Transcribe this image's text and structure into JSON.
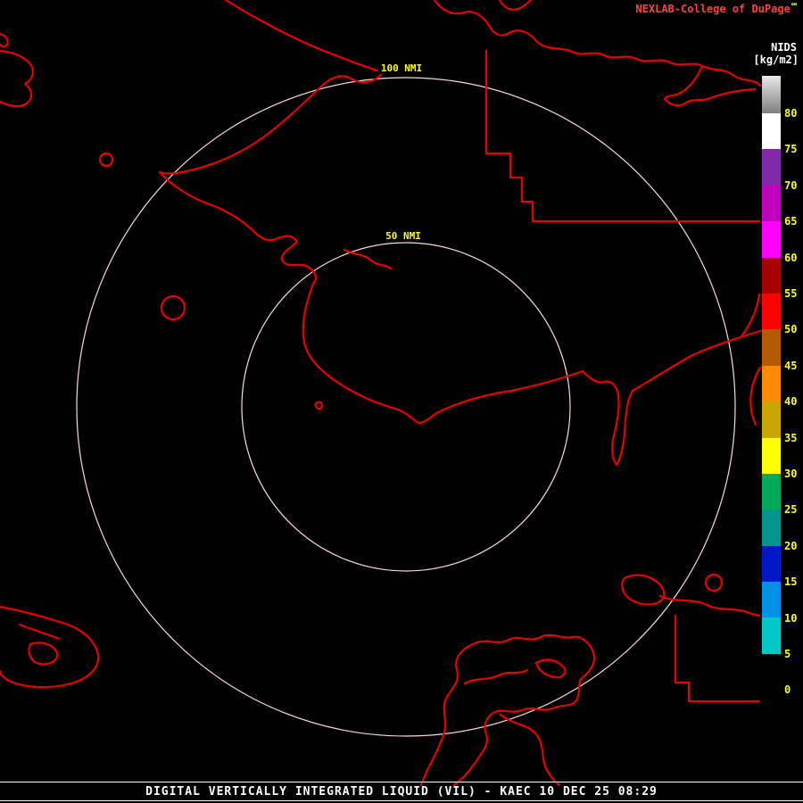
{
  "header": {
    "brand": "NEXLAB-College of DuPage",
    "brand_mark": "℠"
  },
  "scale": {
    "title": "NIDS",
    "units": "[kg/m2]",
    "ticks": [
      "80",
      "75",
      "70",
      "65",
      "60",
      "55",
      "50",
      "45",
      "40",
      "35",
      "30",
      "25",
      "20",
      "15",
      "10",
      "5",
      "0"
    ],
    "gradient_from": "#E8E8E8",
    "gradient_to": "#7F7F7F",
    "segments": [
      {
        "range": "80+",
        "color": "gradient"
      },
      {
        "range": "75-80",
        "color": "#FFFFFF"
      },
      {
        "range": "70-75",
        "color": "#8228AA"
      },
      {
        "range": "65-70",
        "color": "#BE00BE"
      },
      {
        "range": "60-65",
        "color": "#FF00FF"
      },
      {
        "range": "55-60",
        "color": "#A80000"
      },
      {
        "range": "50-55",
        "color": "#FF0000"
      },
      {
        "range": "45-50",
        "color": "#B45A00"
      },
      {
        "range": "40-45",
        "color": "#FF8C00"
      },
      {
        "range": "35-40",
        "color": "#C8A800"
      },
      {
        "range": "30-35",
        "color": "#FFFF00"
      },
      {
        "range": "25-30",
        "color": "#00AA5A"
      },
      {
        "range": "20-25",
        "color": "#00968C"
      },
      {
        "range": "15-20",
        "color": "#0018C8"
      },
      {
        "range": "10-15",
        "color": "#0092E8"
      },
      {
        "range": "5-10",
        "color": "#00C8C8"
      },
      {
        "range": "0-5",
        "color": "#000000"
      }
    ]
  },
  "rings": {
    "outer_label": "100 NMI",
    "inner_label": "50 NMI"
  },
  "footer": {
    "status": "DIGITAL VERTICALLY INTEGRATED LIQUID (VIL) - KAEC 10 DEC 25 08:29"
  },
  "colors": {
    "background": "#000000",
    "map_outline": "#E80000",
    "ring": "#FFD9D9",
    "label": "#FFFF00",
    "brand": "#FF4040",
    "text": "#FFFFFF"
  }
}
